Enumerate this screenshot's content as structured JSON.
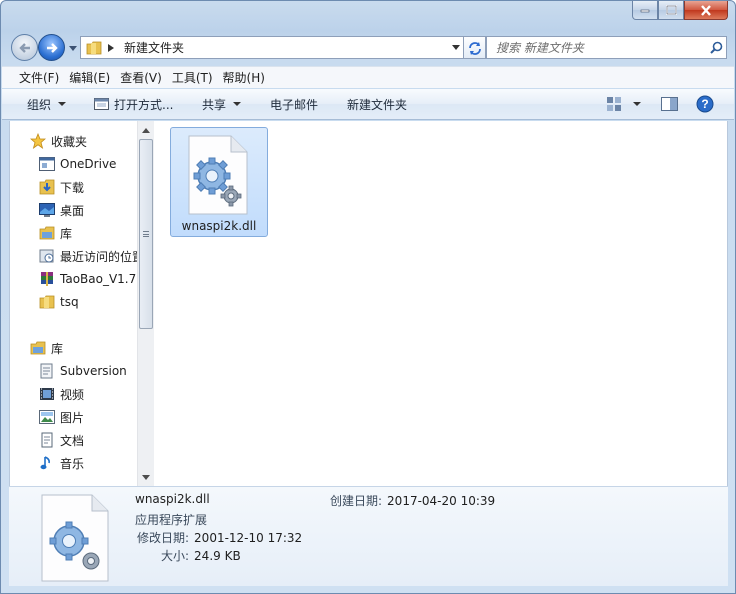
{
  "window": {
    "caption_buttons": [
      "minimize",
      "maximize",
      "close"
    ]
  },
  "address": {
    "path": "新建文件夹",
    "search_placeholder": "搜索 新建文件夹"
  },
  "menu": [
    "文件(F)",
    "编辑(E)",
    "查看(V)",
    "工具(T)",
    "帮助(H)"
  ],
  "toolbar": {
    "organize": "组织",
    "open_with": "打开方式...",
    "share": "共享",
    "email": "电子邮件",
    "new_folder": "新建文件夹"
  },
  "nav": {
    "favorites_header": "收藏夹",
    "favorites": [
      "OneDrive",
      "下载",
      "桌面",
      "库",
      "最近访问的位置",
      "TaoBao_V1.7",
      "tsq"
    ],
    "libraries_header": "库",
    "libraries": [
      "Subversion",
      "视频",
      "图片",
      "文档",
      "音乐"
    ]
  },
  "files": [
    {
      "name": "wnaspi2k.dll",
      "icon": "dll-gear-icon",
      "selected": true
    }
  ],
  "details": {
    "name": "wnaspi2k.dll",
    "type": "应用程序扩展",
    "modified_label": "修改日期:",
    "modified": "2001-12-10 17:32",
    "size_label": "大小:",
    "size": "24.9 KB",
    "created_label": "创建日期:",
    "created": "2017-04-20 10:39"
  },
  "colors": {
    "selection_fill": "#c1dcfc",
    "selection_border": "#84acdd",
    "frame": "#c9dbee"
  }
}
